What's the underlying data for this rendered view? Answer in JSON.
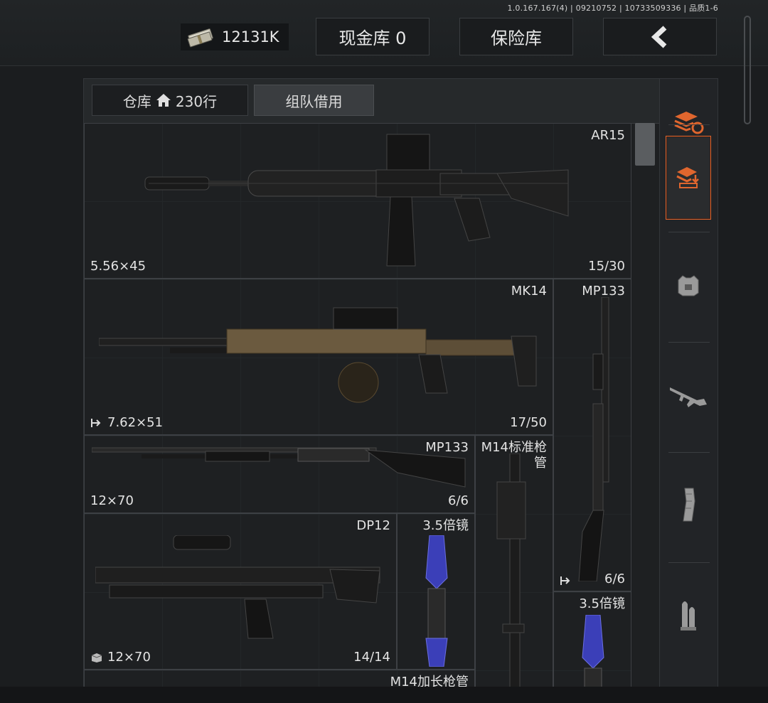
{
  "header": {
    "version": "1.0.167.167(4) | 09210752 | 10733509336 | 品质1-6",
    "money": "12131K",
    "cash_vault_label": "现金库 0",
    "safe_label": "保险库",
    "back_icon": "chevron-left-icon"
  },
  "tabs": {
    "warehouse_label": "仓库",
    "warehouse_rows": "230行",
    "team_borrow_label": "组队借用"
  },
  "items": [
    {
      "name": "AR15",
      "ammo": "5.56×45",
      "count": "15/30"
    },
    {
      "name": "MK14",
      "ammo": "7.62×51",
      "count": "17/50",
      "ammo_icon": "transfer-out-icon"
    },
    {
      "name": "MP133",
      "ammo": "",
      "count": "6/6",
      "ammo_icon": "transfer-out-icon"
    },
    {
      "name": "MP133",
      "ammo": "12×70",
      "count": "6/6"
    },
    {
      "name": "M14标准枪管",
      "ammo": "",
      "count": ""
    },
    {
      "name": "DP12",
      "ammo": "12×70",
      "count": "14/14",
      "ammo_icon": "box-icon"
    },
    {
      "name": "3.5倍镜",
      "ammo": "",
      "count": ""
    },
    {
      "name": "3.5倍镜",
      "ammo": "",
      "count": ""
    },
    {
      "name": "M14加长枪管",
      "ammo": "",
      "count": ""
    }
  ],
  "sidebar": {
    "items": [
      {
        "icon": "stack-refresh-icon",
        "selected": false
      },
      {
        "icon": "stack-download-icon",
        "selected": true
      },
      {
        "icon": "armor-vest-icon",
        "selected": false
      },
      {
        "icon": "rifle-icon",
        "selected": false
      },
      {
        "icon": "magazine-icon",
        "selected": false
      },
      {
        "icon": "bullets-icon",
        "selected": false
      }
    ]
  },
  "colors": {
    "accent": "#e0662e",
    "background": "#1b1d1f"
  }
}
